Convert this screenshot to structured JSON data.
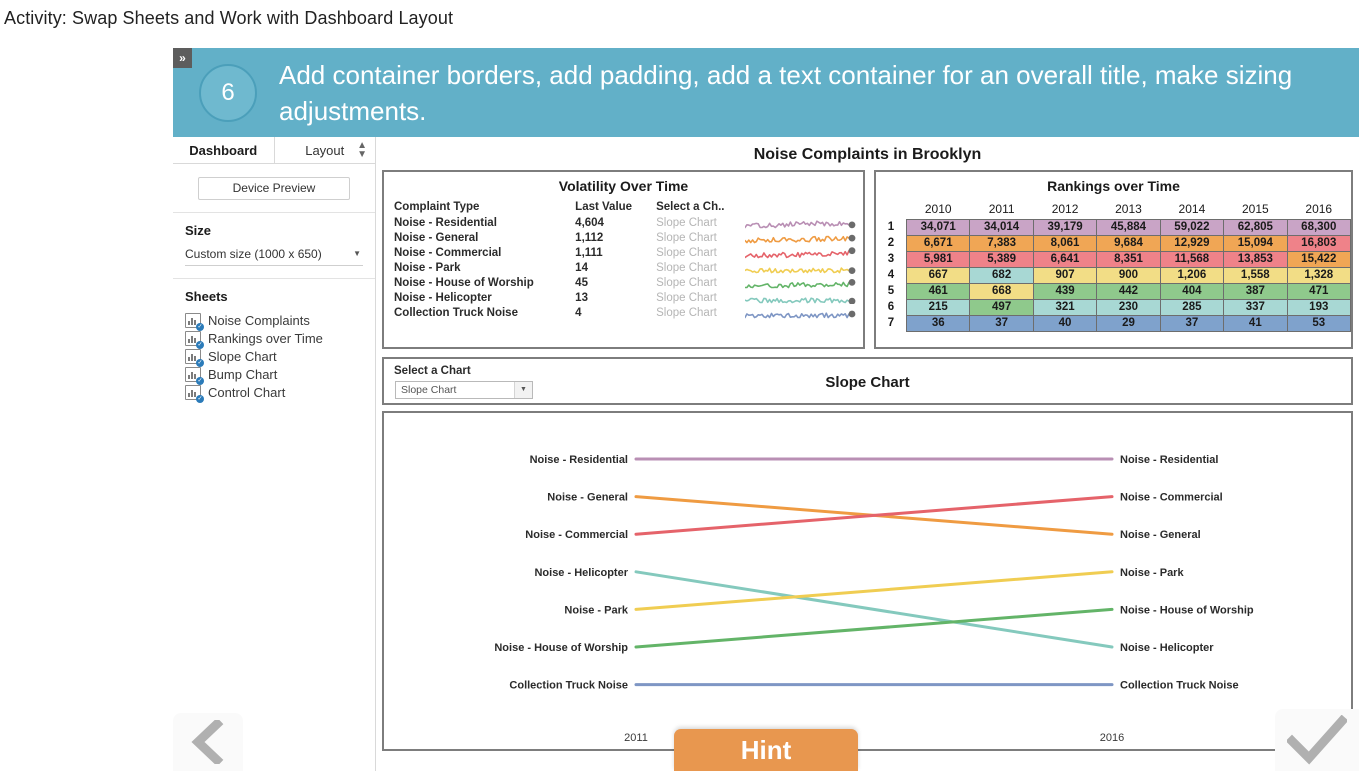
{
  "page": {
    "title": "Activity: Swap Sheets and Work with Dashboard Layout"
  },
  "banner": {
    "step_number": "6",
    "text": "Add container borders, add padding, add a text container for an overall title, make sizing adjustments.",
    "collapse_icon": "»",
    "background": "#62b0c8"
  },
  "sidebar": {
    "tabs": [
      {
        "label": "Dashboard"
      },
      {
        "label": "Layout"
      }
    ],
    "device_preview_label": "Device Preview",
    "size": {
      "heading": "Size",
      "value": "Custom size (1000 x 650)"
    },
    "sheets": {
      "heading": "Sheets",
      "items": [
        {
          "label": "Noise Complaints"
        },
        {
          "label": "Rankings over Time"
        },
        {
          "label": "Slope Chart"
        },
        {
          "label": "Bump Chart"
        },
        {
          "label": "Control Chart"
        }
      ]
    }
  },
  "dashboard": {
    "title": "Noise Complaints in Brooklyn",
    "volatility": {
      "title": "Volatility Over Time",
      "columns": [
        "Complaint Type",
        "Last Value",
        "Select a Ch.."
      ],
      "rows": [
        {
          "type": "Noise - Residential",
          "last_value": "4,604",
          "chart": "Slope Chart",
          "color": "#b98fb4"
        },
        {
          "type": "Noise - General",
          "last_value": "1,112",
          "chart": "Slope Chart",
          "color": "#ef9b42"
        },
        {
          "type": "Noise - Commercial",
          "last_value": "1,111",
          "chart": "Slope Chart",
          "color": "#e5636a"
        },
        {
          "type": "Noise - Park",
          "last_value": "14",
          "chart": "Slope Chart",
          "color": "#f0cd52"
        },
        {
          "type": "Noise - House of Worship",
          "last_value": "45",
          "chart": "Slope Chart",
          "color": "#63b468"
        },
        {
          "type": "Noise - Helicopter",
          "last_value": "13",
          "chart": "Slope Chart",
          "color": "#84c9bd"
        },
        {
          "type": "Collection Truck Noise",
          "last_value": "4",
          "chart": "Slope Chart",
          "color": "#7e96c4"
        }
      ]
    },
    "rankings": {
      "title": "Rankings over Time",
      "years": [
        "2010",
        "2011",
        "2012",
        "2013",
        "2014",
        "2015",
        "2016"
      ],
      "ranks": [
        "1",
        "2",
        "3",
        "4",
        "5",
        "6",
        "7"
      ],
      "rows": [
        {
          "rank": "1",
          "values": [
            "34,071",
            "34,014",
            "39,179",
            "45,884",
            "59,022",
            "62,805",
            "68,300"
          ],
          "colors": [
            "#c9a4c6",
            "#c9a4c6",
            "#c9a4c6",
            "#c9a4c6",
            "#c9a4c6",
            "#c9a4c6",
            "#c9a4c6"
          ]
        },
        {
          "rank": "2",
          "values": [
            "6,671",
            "7,383",
            "8,061",
            "9,684",
            "12,929",
            "15,094",
            "16,803"
          ],
          "colors": [
            "#f0a655",
            "#f0a655",
            "#f0a655",
            "#f0a655",
            "#f0a655",
            "#f0a655",
            "#ef8289"
          ]
        },
        {
          "rank": "3",
          "values": [
            "5,981",
            "5,389",
            "6,641",
            "8,351",
            "11,568",
            "13,853",
            "15,422"
          ],
          "colors": [
            "#ef8289",
            "#ef8289",
            "#ef8289",
            "#ef8289",
            "#ef8289",
            "#ef8289",
            "#f0a655"
          ]
        },
        {
          "rank": "4",
          "values": [
            "667",
            "682",
            "907",
            "900",
            "1,206",
            "1,558",
            "1,328"
          ],
          "colors": [
            "#f2dd86",
            "#a8d8d4",
            "#f2dd86",
            "#f2dd86",
            "#f2dd86",
            "#f2dd86",
            "#f2dd86"
          ]
        },
        {
          "rank": "5",
          "values": [
            "461",
            "668",
            "439",
            "442",
            "404",
            "387",
            "471"
          ],
          "colors": [
            "#8fc98c",
            "#f2dd86",
            "#8fc98c",
            "#8fc98c",
            "#8fc98c",
            "#8fc98c",
            "#8fc98c"
          ]
        },
        {
          "rank": "6",
          "values": [
            "215",
            "497",
            "321",
            "230",
            "285",
            "337",
            "193"
          ],
          "colors": [
            "#a8d8d4",
            "#8fc98c",
            "#a8d8d4",
            "#a8d8d4",
            "#a8d8d4",
            "#a8d8d4",
            "#a8d8d4"
          ]
        },
        {
          "rank": "7",
          "values": [
            "36",
            "37",
            "40",
            "29",
            "37",
            "41",
            "53"
          ],
          "colors": [
            "#7fa2cc",
            "#7fa2cc",
            "#7fa2cc",
            "#7fa2cc",
            "#7fa2cc",
            "#7fa2cc",
            "#7fa2cc"
          ]
        }
      ]
    },
    "selector": {
      "label": "Select a Chart",
      "value": "Slope Chart",
      "chart_title": "Slope Chart"
    }
  },
  "chart_data": {
    "type": "line",
    "title": "Slope Chart",
    "xlabel": "",
    "ylabel": "",
    "x": [
      "2011",
      "2016"
    ],
    "axis_tick_labels": [
      "2011",
      "2016"
    ],
    "grid": false,
    "legend": "inline-endpoint-labels",
    "note": "Slope chart: rank position at 2011 (left) vs 2016 (right); rank 1 at top.",
    "series": [
      {
        "name": "Noise - Residential",
        "color": "#b98fb4",
        "left_rank": 1,
        "right_rank": 1
      },
      {
        "name": "Noise - General",
        "color": "#ef9b42",
        "left_rank": 2,
        "right_rank": 3
      },
      {
        "name": "Noise - Commercial",
        "color": "#e5636a",
        "left_rank": 3,
        "right_rank": 2
      },
      {
        "name": "Noise - Helicopter",
        "color": "#84c9bd",
        "left_rank": 4,
        "right_rank": 6
      },
      {
        "name": "Noise - Park",
        "color": "#f0cd52",
        "left_rank": 5,
        "right_rank": 4
      },
      {
        "name": "Noise - House of Worship",
        "color": "#63b468",
        "left_rank": 6,
        "right_rank": 5
      },
      {
        "name": "Collection Truck Noise",
        "color": "#7e96c4",
        "left_rank": 7,
        "right_rank": 7
      }
    ],
    "left_labels": [
      "Noise - Residential",
      "Noise - General",
      "Noise - Commercial",
      "Noise - Helicopter",
      "Noise - Park",
      "Noise - House of Worship",
      "Collection Truck Noise"
    ],
    "right_labels": [
      "Noise - Residential",
      "Noise - Commercial",
      "Noise - General",
      "Noise - Park",
      "Noise - House of Worship",
      "Noise - Helicopter",
      "Collection Truck Noise"
    ]
  },
  "controls": {
    "prev_label": "‹",
    "next_label": "✓",
    "hint_label": "Hint",
    "hint_color": "#e8974f"
  }
}
